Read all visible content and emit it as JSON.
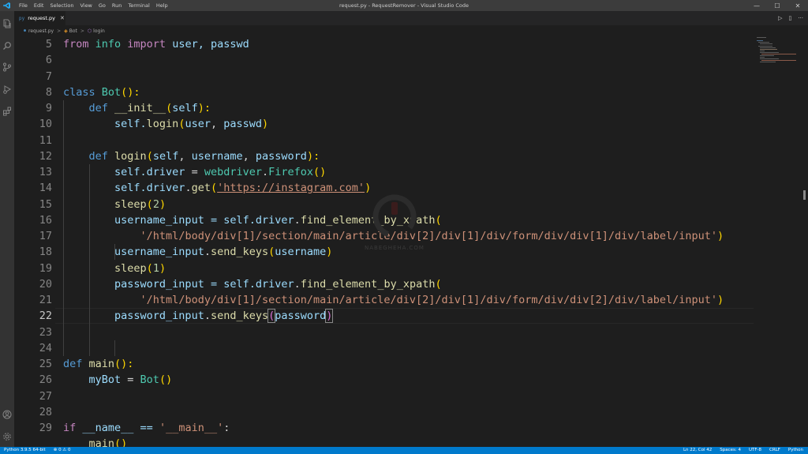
{
  "window": {
    "title": "request.py - RequestRemover - Visual Studio Code",
    "menu": [
      "File",
      "Edit",
      "Selection",
      "View",
      "Go",
      "Run",
      "Terminal",
      "Help"
    ],
    "controls": {
      "minimize": "—",
      "maximize": "☐",
      "close": "✕"
    }
  },
  "tab": {
    "icon": "py",
    "label": "request.py",
    "close": "✕"
  },
  "editor_actions": {
    "run": "▷",
    "split": "▯",
    "more": "···"
  },
  "breadcrumb": {
    "file": "request.py",
    "class": "Bot",
    "method": "login",
    "sep": ">"
  },
  "code": {
    "line_numbers": [
      "5",
      "6",
      "7",
      "8",
      "9",
      "10",
      "11",
      "12",
      "13",
      "14",
      "15",
      "16",
      "17",
      "18",
      "19",
      "20",
      "21",
      "22",
      "23",
      "24",
      "25",
      "26",
      "27",
      "28",
      "29"
    ],
    "l5": {
      "a": "from",
      "b": " info ",
      "c": "import",
      "d": " user, passwd"
    },
    "l8": {
      "a": "class",
      "b": " ",
      "c": "Bot",
      "d": "():"
    },
    "l9": {
      "a": "    ",
      "b": "def",
      "c": " ",
      "d": "__init__",
      "e": "(",
      "f": "self",
      "g": "):"
    },
    "l10": {
      "a": "        self.",
      "b": "login",
      "c": "(",
      "d": "user",
      "e": ", ",
      "f": "passwd",
      "g": ")"
    },
    "l12": {
      "a": "    ",
      "b": "def",
      "c": " ",
      "d": "login",
      "e": "(",
      "f": "self",
      "g": ", ",
      "h": "username",
      "i": ", ",
      "j": "password",
      "k": "):"
    },
    "l13": {
      "a": "        self.",
      "b": "driver",
      "c": " = ",
      "d": "webdriver",
      "e": ".",
      "f": "Firefox",
      "g": "()"
    },
    "l14": {
      "a": "        self.",
      "b": "driver",
      "c": ".",
      "d": "get",
      "e": "(",
      "f": "'https://instagram.com'",
      "g": ")"
    },
    "l15": {
      "a": "        ",
      "b": "sleep",
      "c": "(",
      "d": "2",
      "e": ")"
    },
    "l16": {
      "a": "        ",
      "b": "username_input",
      "c": " = self.",
      "d": "driver",
      "e": ".",
      "f": "find_element_by_xpath",
      "g": "("
    },
    "l17": {
      "a": "            ",
      "b": "'/html/body/div[1]/section/main/article/div[2]/div[1]/div/form/div/div[1]/div/label/input'",
      "c": ")"
    },
    "l18": {
      "a": "        ",
      "b": "username_input",
      "c": ".",
      "d": "send_keys",
      "e": "(",
      "f": "username",
      "g": ")"
    },
    "l19": {
      "a": "        ",
      "b": "sleep",
      "c": "(",
      "d": "1",
      "e": ")"
    },
    "l20": {
      "a": "        ",
      "b": "password_input",
      "c": " = self.",
      "d": "driver",
      "e": ".",
      "f": "find_element_by_xpath",
      "g": "("
    },
    "l21": {
      "a": "            ",
      "b": "'/html/body/div[1]/section/main/article/div[2]/div[1]/div/form/div/div[2]/div/label/input'",
      "c": ")"
    },
    "l22": {
      "a": "        ",
      "b": "password_input",
      "c": ".",
      "d": "send_keys",
      "e": "(",
      "f": "password",
      "g": ")"
    },
    "l25": {
      "a": "def",
      "b": " ",
      "c": "main",
      "d": "():"
    },
    "l26": {
      "a": "    ",
      "b": "myBot",
      "c": " = ",
      "d": "Bot",
      "e": "()"
    },
    "l29": {
      "a": "if",
      "b": " __name__ == ",
      "c": "'__main__'",
      "d": ":"
    },
    "l30": {
      "a": "    ",
      "b": "main",
      "c": "()"
    }
  },
  "watermark": "NABEGHEHA.COM",
  "status": {
    "interpreter": "Python 3.9.5 64-bit",
    "problems": "⊗ 0 ⚠ 0",
    "position": "Ln 22, Col 42",
    "spaces": "Spaces: 4",
    "encoding": "UTF-8",
    "eol": "CRLF",
    "language": "Python"
  },
  "colors": {
    "statusbar": "#007acc",
    "keyword": "#569cd6",
    "class": "#4ec9b0",
    "function": "#dcdcaa",
    "string": "#ce9178"
  }
}
